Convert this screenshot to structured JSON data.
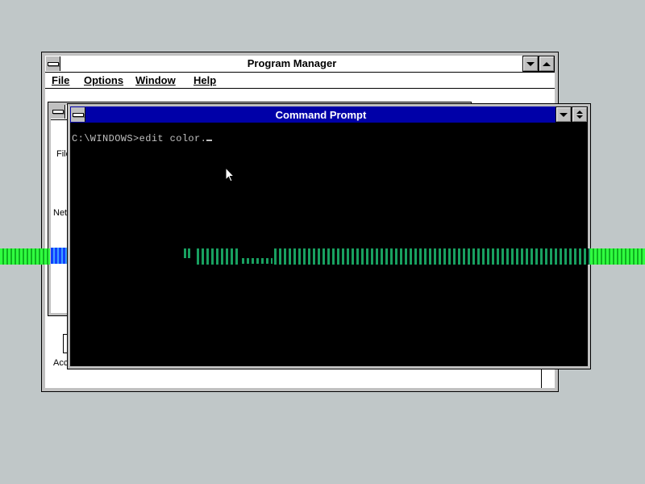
{
  "desktop": {
    "background_color": "#c0c7c8"
  },
  "program_manager": {
    "title": "Program Manager",
    "menu": {
      "file": "File",
      "options": "Options",
      "window": "Window",
      "help": "Help"
    },
    "group_window": {
      "label_file": "File",
      "label_net": "Net"
    },
    "accessories_label": "Acc"
  },
  "command_prompt": {
    "title": "Command Prompt",
    "title_bar_color": "#0000a8",
    "screen_text": "C:\\WINDOWS>edit color."
  },
  "icons": {
    "system_menu": "system-menu-icon",
    "minimize": "minimize-arrow-icon",
    "maximize": "maximize-arrow-icon",
    "restore": "restore-arrows-icon",
    "pointer": "mouse-pointer-icon"
  }
}
